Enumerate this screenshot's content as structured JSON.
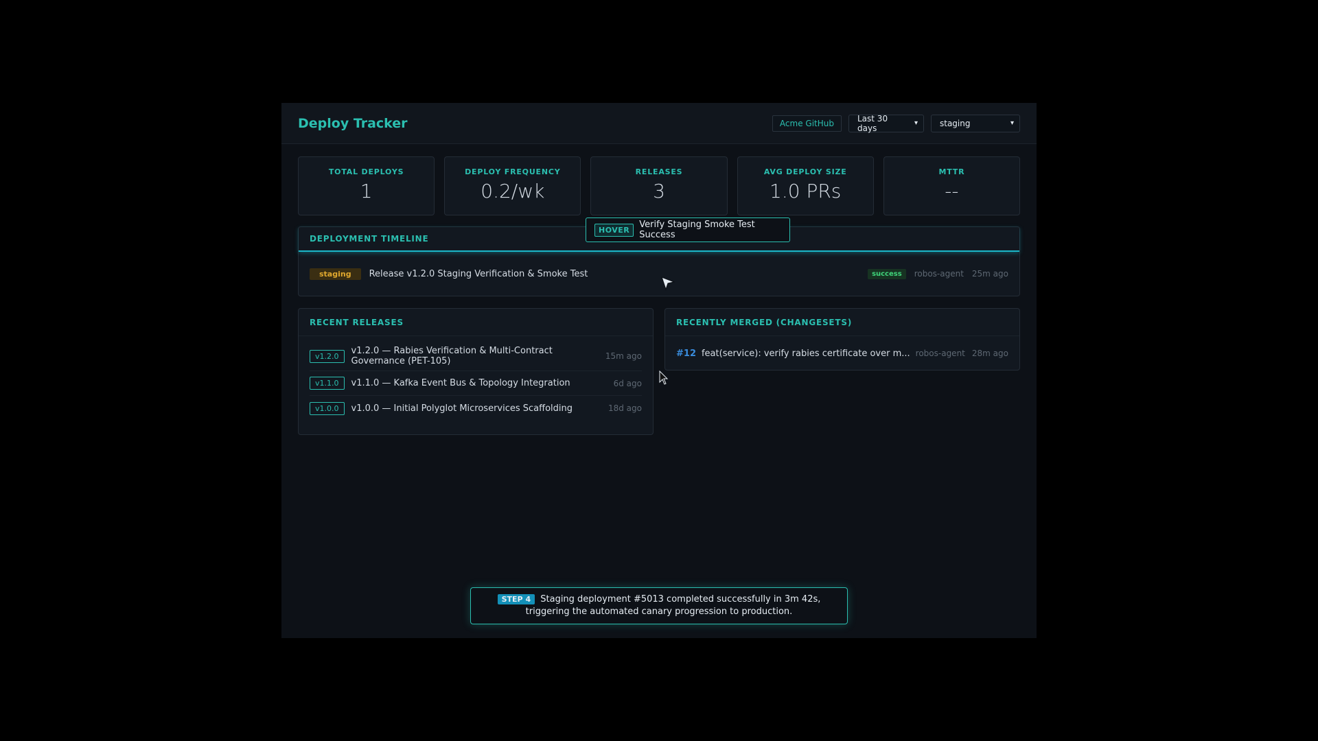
{
  "header": {
    "title": "Deploy Tracker",
    "org_button": "Acme GitHub",
    "range_select": "Last 30 days",
    "env_select": "staging"
  },
  "stats": [
    {
      "label": "TOTAL DEPLOYS",
      "value": "1"
    },
    {
      "label": "DEPLOY FREQUENCY",
      "value": "0.2/wk"
    },
    {
      "label": "RELEASES",
      "value": "3"
    },
    {
      "label": "AVG DEPLOY SIZE",
      "value": "1.0 PRs"
    },
    {
      "label": "MTTR",
      "value": "--"
    }
  ],
  "timeline": {
    "title": "DEPLOYMENT TIMELINE",
    "rows": [
      {
        "env": "staging",
        "text": "Release v1.2.0 Staging Verification & Smoke Test",
        "status": "success",
        "author": "robos-agent",
        "time": "25m ago"
      }
    ]
  },
  "releases": {
    "title": "RECENT RELEASES",
    "items": [
      {
        "tag": "v1.2.0",
        "text": "v1.2.0 — Rabies Verification & Multi-Contract Governance (PET-105)",
        "time": "15m ago"
      },
      {
        "tag": "v1.1.0",
        "text": "v1.1.0 — Kafka Event Bus & Topology Integration",
        "time": "6d ago"
      },
      {
        "tag": "v1.0.0",
        "text": "v1.0.0 — Initial Polyglot Microservices Scaffolding",
        "time": "18d ago"
      }
    ]
  },
  "merged": {
    "title": "RECENTLY MERGED (CHANGESETS)",
    "items": [
      {
        "number": "#12",
        "text": "feat(service): verify rabies certificate over m...",
        "author": "robos-agent",
        "time": "28m ago"
      }
    ]
  },
  "hover_tip": {
    "tag": "HOVER",
    "text": "Verify Staging Smoke Test Success"
  },
  "step": {
    "tag": "STEP 4",
    "text": "Staging deployment #5013 completed successfully in 3m 42s, triggering the automated canary progression to production."
  },
  "colors": {
    "accent": "#2bbfb0",
    "staging": "#e0a82e",
    "success": "#3fd47a",
    "link": "#3a8dde",
    "background": "#0d1117"
  }
}
